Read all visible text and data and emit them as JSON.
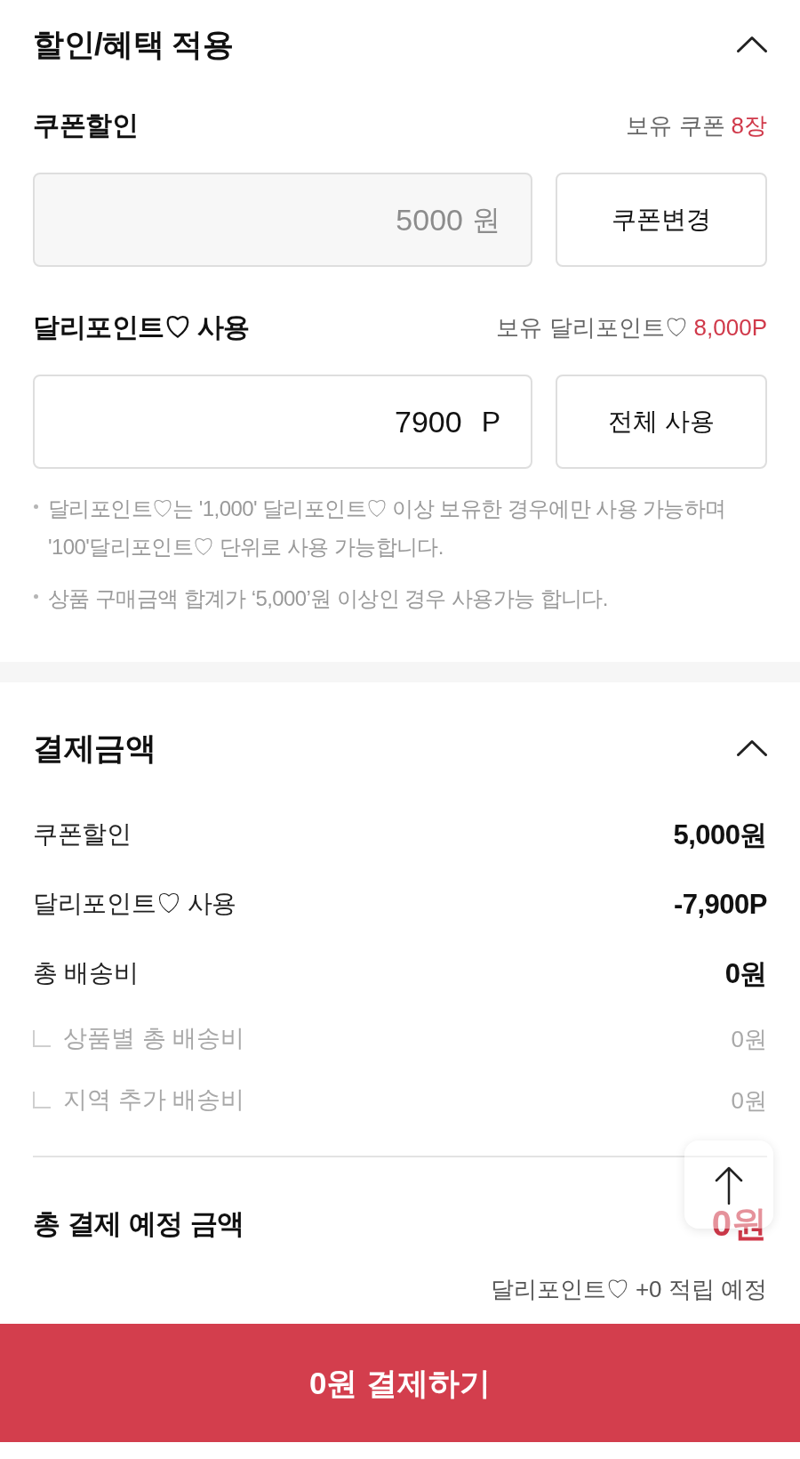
{
  "discount_section": {
    "title": "할인/혜택 적용",
    "expanded": true,
    "coupon": {
      "label": "쿠폰할인",
      "owned_label": "보유 쿠폰",
      "owned_count": "8장",
      "field": {
        "value": "5000",
        "unit": "원",
        "disabled": true
      },
      "button": "쿠폰변경"
    },
    "points": {
      "label": "달리포인트♡ 사용",
      "owned_label": "보유 달리포인트♡",
      "owned_count": "8,000P",
      "field": {
        "value": "7900",
        "unit": "P",
        "disabled": false
      },
      "button": "전체 사용"
    },
    "notes": [
      "달리포인트♡는 '1,000' 달리포인트♡ 이상 보유한 경우에만 사용 가능하며 '100'달리포인트♡ 단위로 사용 가능합니다.",
      "상품 구매금액 합계가 ‘5,000’원 이상인 경우 사용가능 합니다."
    ]
  },
  "payment_section": {
    "title": "결제금액",
    "expanded": true,
    "rows": [
      {
        "label": "쿠폰할인",
        "value": "5,000원"
      },
      {
        "label": "달리포인트♡ 사용",
        "value": "-7,900P"
      },
      {
        "label": "총 배송비",
        "value": "0원",
        "children": [
          {
            "label": "상품별 총 배송비",
            "value": "0원"
          },
          {
            "label": "지역 추가 배송비",
            "value": "0원"
          }
        ]
      }
    ],
    "total": {
      "label": "총 결제 예정 금액",
      "value": "0원",
      "reward": "달리포인트♡ +0 적립 예정"
    }
  },
  "pay_button": "0원 결제하기"
}
